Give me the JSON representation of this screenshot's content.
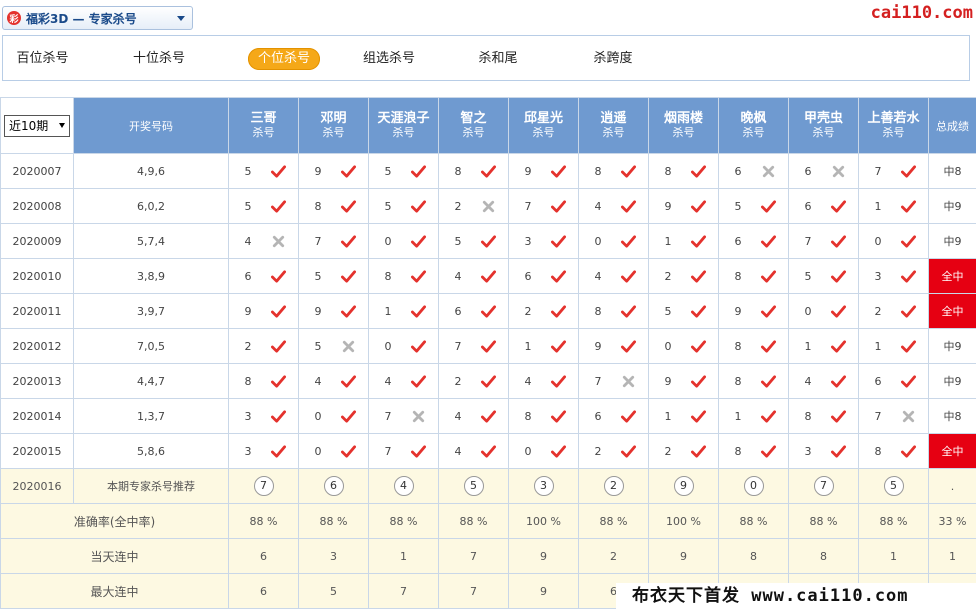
{
  "header": {
    "lottery_select": "福彩3D — 专家杀号",
    "logo_char": "彩",
    "site": "cai110.com"
  },
  "tabs": [
    "百位杀号",
    "十位杀号",
    "个位杀号",
    "组选杀号",
    "杀和尾",
    "杀跨度"
  ],
  "active_tab": 2,
  "table": {
    "period_select": "近10期",
    "draw_col": "开奖号码",
    "sub_label": "杀号",
    "total_col": "总成绩",
    "experts": [
      "三哥",
      "邓明",
      "天涯浪子",
      "智之",
      "邱星光",
      "逍遥",
      "烟雨楼",
      "晚枫",
      "甲壳虫",
      "上善若水"
    ],
    "rows": [
      {
        "issue": "2020007",
        "draw": "4,9,6",
        "kills": [
          [
            "5",
            true
          ],
          [
            "9",
            true
          ],
          [
            "5",
            true
          ],
          [
            "8",
            true
          ],
          [
            "9",
            true
          ],
          [
            "8",
            true
          ],
          [
            "8",
            true
          ],
          [
            "6",
            false
          ],
          [
            "6",
            false
          ],
          [
            "7",
            true
          ]
        ],
        "result": "中8",
        "full": false
      },
      {
        "issue": "2020008",
        "draw": "6,0,2",
        "kills": [
          [
            "5",
            true
          ],
          [
            "8",
            true
          ],
          [
            "5",
            true
          ],
          [
            "2",
            false
          ],
          [
            "7",
            true
          ],
          [
            "4",
            true
          ],
          [
            "9",
            true
          ],
          [
            "5",
            true
          ],
          [
            "6",
            true
          ],
          [
            "1",
            true
          ]
        ],
        "result": "中9",
        "full": false
      },
      {
        "issue": "2020009",
        "draw": "5,7,4",
        "kills": [
          [
            "4",
            false
          ],
          [
            "7",
            true
          ],
          [
            "0",
            true
          ],
          [
            "5",
            true
          ],
          [
            "3",
            true
          ],
          [
            "0",
            true
          ],
          [
            "1",
            true
          ],
          [
            "6",
            true
          ],
          [
            "7",
            true
          ],
          [
            "0",
            true
          ]
        ],
        "result": "中9",
        "full": false
      },
      {
        "issue": "2020010",
        "draw": "3,8,9",
        "kills": [
          [
            "6",
            true
          ],
          [
            "5",
            true
          ],
          [
            "8",
            true
          ],
          [
            "4",
            true
          ],
          [
            "6",
            true
          ],
          [
            "4",
            true
          ],
          [
            "2",
            true
          ],
          [
            "8",
            true
          ],
          [
            "5",
            true
          ],
          [
            "3",
            true
          ]
        ],
        "result": "全中",
        "full": true
      },
      {
        "issue": "2020011",
        "draw": "3,9,7",
        "kills": [
          [
            "9",
            true
          ],
          [
            "9",
            true
          ],
          [
            "1",
            true
          ],
          [
            "6",
            true
          ],
          [
            "2",
            true
          ],
          [
            "8",
            true
          ],
          [
            "5",
            true
          ],
          [
            "9",
            true
          ],
          [
            "0",
            true
          ],
          [
            "2",
            true
          ]
        ],
        "result": "全中",
        "full": true
      },
      {
        "issue": "2020012",
        "draw": "7,0,5",
        "kills": [
          [
            "2",
            true
          ],
          [
            "5",
            false
          ],
          [
            "0",
            true
          ],
          [
            "7",
            true
          ],
          [
            "1",
            true
          ],
          [
            "9",
            true
          ],
          [
            "0",
            true
          ],
          [
            "8",
            true
          ],
          [
            "1",
            true
          ],
          [
            "1",
            true
          ]
        ],
        "result": "中9",
        "full": false
      },
      {
        "issue": "2020013",
        "draw": "4,4,7",
        "kills": [
          [
            "8",
            true
          ],
          [
            "4",
            true
          ],
          [
            "4",
            true
          ],
          [
            "2",
            true
          ],
          [
            "4",
            true
          ],
          [
            "7",
            false
          ],
          [
            "9",
            true
          ],
          [
            "8",
            true
          ],
          [
            "4",
            true
          ],
          [
            "6",
            true
          ]
        ],
        "result": "中9",
        "full": false
      },
      {
        "issue": "2020014",
        "draw": "1,3,7",
        "kills": [
          [
            "3",
            true
          ],
          [
            "0",
            true
          ],
          [
            "7",
            false
          ],
          [
            "4",
            true
          ],
          [
            "8",
            true
          ],
          [
            "6",
            true
          ],
          [
            "1",
            true
          ],
          [
            "1",
            true
          ],
          [
            "8",
            true
          ],
          [
            "7",
            false
          ]
        ],
        "result": "中8",
        "full": false
      },
      {
        "issue": "2020015",
        "draw": "5,8,6",
        "kills": [
          [
            "3",
            true
          ],
          [
            "0",
            true
          ],
          [
            "7",
            true
          ],
          [
            "4",
            true
          ],
          [
            "0",
            true
          ],
          [
            "2",
            true
          ],
          [
            "2",
            true
          ],
          [
            "8",
            true
          ],
          [
            "3",
            true
          ],
          [
            "8",
            true
          ]
        ],
        "result": "全中",
        "full": true
      }
    ],
    "recommend": {
      "issue": "2020016",
      "label": "本期专家杀号推荐",
      "balls": [
        "7",
        "6",
        "4",
        "5",
        "3",
        "2",
        "9",
        "0",
        "7",
        "5"
      ],
      "total": "."
    },
    "stats": [
      {
        "label": "准确率(全中率)",
        "values": [
          "88 %",
          "88 %",
          "88 %",
          "88 %",
          "100 %",
          "88 %",
          "100 %",
          "88 %",
          "88 %",
          "88 %"
        ],
        "total": "33 %"
      },
      {
        "label": "当天连中",
        "values": [
          "6",
          "3",
          "1",
          "7",
          "9",
          "2",
          "9",
          "8",
          "8",
          "1"
        ],
        "total": "1"
      },
      {
        "label": "最大连中",
        "values": [
          "6",
          "5",
          "7",
          "7",
          "9",
          "6",
          "",
          "",
          "",
          ""
        ],
        "total": ""
      }
    ]
  },
  "watermark": "布衣天下首发 www.cai110.com",
  "colors": {
    "header_blue": "#6f9ad0",
    "hit_red": "#e4322d",
    "miss_gray": "#b5b5b5",
    "full_red": "#e60012",
    "tab_active": "#f5a818"
  }
}
